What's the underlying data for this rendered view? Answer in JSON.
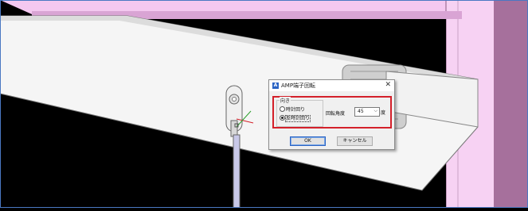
{
  "dialog": {
    "title": "AMP端子回転",
    "close_glyph": "✕",
    "app_icon": "A",
    "direction_group": {
      "label": "向き",
      "options": [
        {
          "label": "時計回り",
          "selected": false
        },
        {
          "label": "反時計回り",
          "selected": true
        }
      ]
    },
    "angle": {
      "label": "回転角度",
      "value": "45",
      "unit": "度"
    },
    "buttons": {
      "ok": "OK",
      "cancel": "キャンセル"
    }
  },
  "colors": {
    "highlight": "#d4202a",
    "accent": "#2a63c4",
    "pink_wall": "#f2c3ef",
    "background": "#000000"
  },
  "icons": [
    "close-icon",
    "app-icon",
    "chevron-down-icon"
  ]
}
